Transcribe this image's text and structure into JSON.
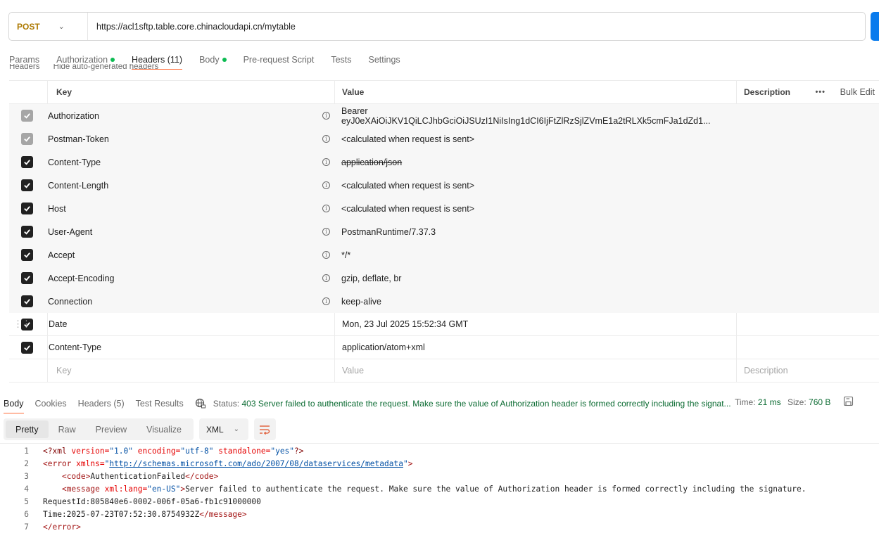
{
  "request": {
    "method": "POST",
    "url": "https://acl1sftp.table.core.chinacloudapi.cn/mytable"
  },
  "request_tabs": [
    {
      "label": "Params",
      "dot": false,
      "active": false
    },
    {
      "label": "Authorization",
      "dot": true,
      "active": false
    },
    {
      "label": "Headers (11)",
      "dot": false,
      "active": true
    },
    {
      "label": "Body",
      "dot": true,
      "active": false
    },
    {
      "label": "Pre-request Script",
      "dot": false,
      "active": false
    },
    {
      "label": "Tests",
      "dot": false,
      "active": false
    },
    {
      "label": "Settings",
      "dot": false,
      "active": false
    }
  ],
  "headers_section": {
    "title": "Headers",
    "toggle": "Hide auto-generated headers"
  },
  "table": {
    "col_key": "Key",
    "col_value": "Value",
    "col_description": "Description",
    "bulk_edit": "Bulk Edit",
    "rows": [
      {
        "key": "Authorization",
        "value": "Bearer eyJ0eXAiOiJKV1QiLCJhbGciOiJSUzI1NiIsIng1dCI6IjFtZlRzSjlZVmE1a2tRLXk5cmFJa1dZd1...",
        "description": "",
        "checked": true,
        "disabled": true,
        "auto": true,
        "strike": false
      },
      {
        "key": "Postman-Token",
        "value": "<calculated when request is sent>",
        "description": "",
        "checked": true,
        "disabled": true,
        "auto": true,
        "strike": false
      },
      {
        "key": "Content-Type",
        "value": "application/json",
        "description": "",
        "checked": true,
        "disabled": false,
        "auto": true,
        "strike": true
      },
      {
        "key": "Content-Length",
        "value": "<calculated when request is sent>",
        "description": "",
        "checked": true,
        "disabled": false,
        "auto": true,
        "strike": false
      },
      {
        "key": "Host",
        "value": "<calculated when request is sent>",
        "description": "",
        "checked": true,
        "disabled": false,
        "auto": true,
        "strike": false
      },
      {
        "key": "User-Agent",
        "value": "PostmanRuntime/7.37.3",
        "description": "",
        "checked": true,
        "disabled": false,
        "auto": true,
        "strike": false
      },
      {
        "key": "Accept",
        "value": "*/*",
        "description": "",
        "checked": true,
        "disabled": false,
        "auto": true,
        "strike": false
      },
      {
        "key": "Accept-Encoding",
        "value": "gzip, deflate, br",
        "description": "",
        "checked": true,
        "disabled": false,
        "auto": true,
        "strike": false
      },
      {
        "key": "Connection",
        "value": "keep-alive",
        "description": "",
        "checked": true,
        "disabled": false,
        "auto": true,
        "strike": false
      },
      {
        "key": "Date",
        "value": "Mon, 23 Jul 2025 15:52:34 GMT",
        "description": "",
        "checked": true,
        "disabled": false,
        "auto": false,
        "strike": false
      },
      {
        "key": "Content-Type",
        "value": "application/atom+xml",
        "description": "",
        "checked": true,
        "disabled": false,
        "auto": false,
        "strike": false
      }
    ],
    "new_row": {
      "key_placeholder": "Key",
      "value_placeholder": "Value",
      "description_placeholder": "Description"
    }
  },
  "response_tabs": [
    {
      "label": "Body",
      "active": true
    },
    {
      "label": "Cookies",
      "active": false
    },
    {
      "label": "Headers (5)",
      "active": false
    },
    {
      "label": "Test Results",
      "active": false
    }
  ],
  "response_status": {
    "prefix": "Status:",
    "code_text": "403 Server failed to authenticate the request. Make sure the value of Authorization header is formed correctly including the signat...",
    "time_label": "Time:",
    "time_value": "21 ms",
    "size_label": "Size:",
    "size_value": "760 B"
  },
  "body_formats": [
    {
      "label": "Pretty",
      "active": true
    },
    {
      "label": "Raw",
      "active": false
    },
    {
      "label": "Preview",
      "active": false
    },
    {
      "label": "Visualize",
      "active": false
    }
  ],
  "body_language": "XML",
  "code_lines": [
    "1",
    "2",
    "3",
    "4",
    "5",
    "6",
    "7"
  ],
  "xml": {
    "l1_decl_open": "<?xml",
    "l1_attr1": " version=",
    "l1_val1": "\"1.0\"",
    "l1_attr2": " encoding=",
    "l1_val2": "\"utf-8\"",
    "l1_attr3": " standalone=",
    "l1_val3": "\"yes\"",
    "l1_close": "?>",
    "l2_open": "<error",
    "l2_attr": " xmlns=",
    "l2_q1": "\"",
    "l2_link": "http://schemas.microsoft.com/ado/2007/08/dataservices/metadata",
    "l2_q2": "\"",
    "l2_close": ">",
    "l3_indent": "    ",
    "l3_open": "<code>",
    "l3_text": "AuthenticationFailed",
    "l3_close": "</code>",
    "l4_indent": "    ",
    "l4_open": "<message",
    "l4_attr": " xml:lang=",
    "l4_val": "\"en-US\"",
    "l4_gt": ">",
    "l4_text": "Server failed to authenticate the request. Make sure the value of Authorization header is formed correctly including the signature.",
    "l5_text": "RequestId:805840e6-0002-006f-05a6-fb1c91000000",
    "l6_text": "Time:2025-07-23T07:52:30.8754932Z",
    "l6_close": "</message>",
    "l7_close": "</error>"
  }
}
